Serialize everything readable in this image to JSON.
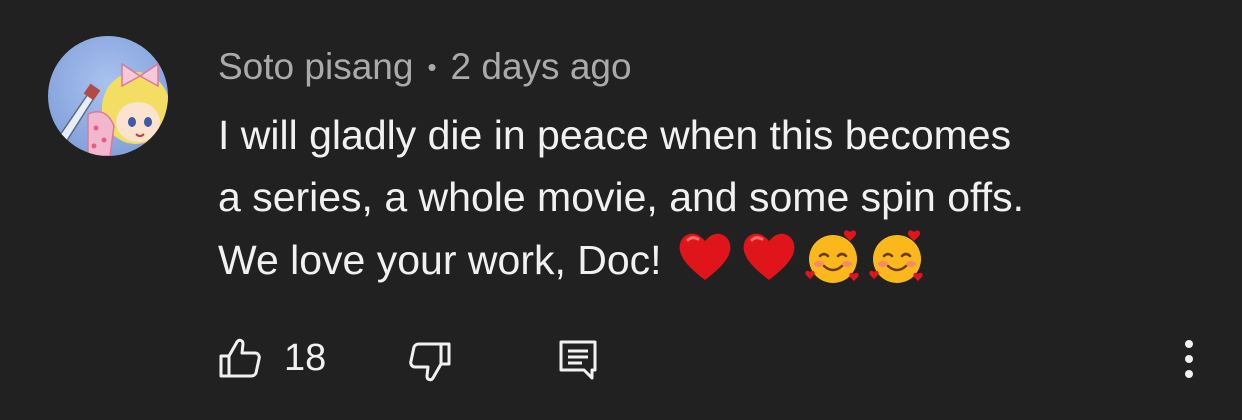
{
  "comment": {
    "author": "Soto pisang",
    "separator": "•",
    "time": "2 days ago",
    "text_lines": [
      "I will gladly die in peace when this becomes",
      "a series, a whole movie, and some spin offs.",
      "We love your work, Doc!"
    ],
    "emojis": [
      "red-heart",
      "red-heart",
      "smiling-face-with-hearts",
      "smiling-face-with-hearts"
    ]
  },
  "actions": {
    "like_count": "18",
    "like_icon": "thumbs-up-icon",
    "dislike_icon": "thumbs-down-icon",
    "reply_icon": "reply-comment-icon",
    "more_icon": "more-vertical-icon"
  },
  "colors": {
    "background": "#212121",
    "text": "#f1f1f1",
    "meta": "#aaaaaa"
  }
}
